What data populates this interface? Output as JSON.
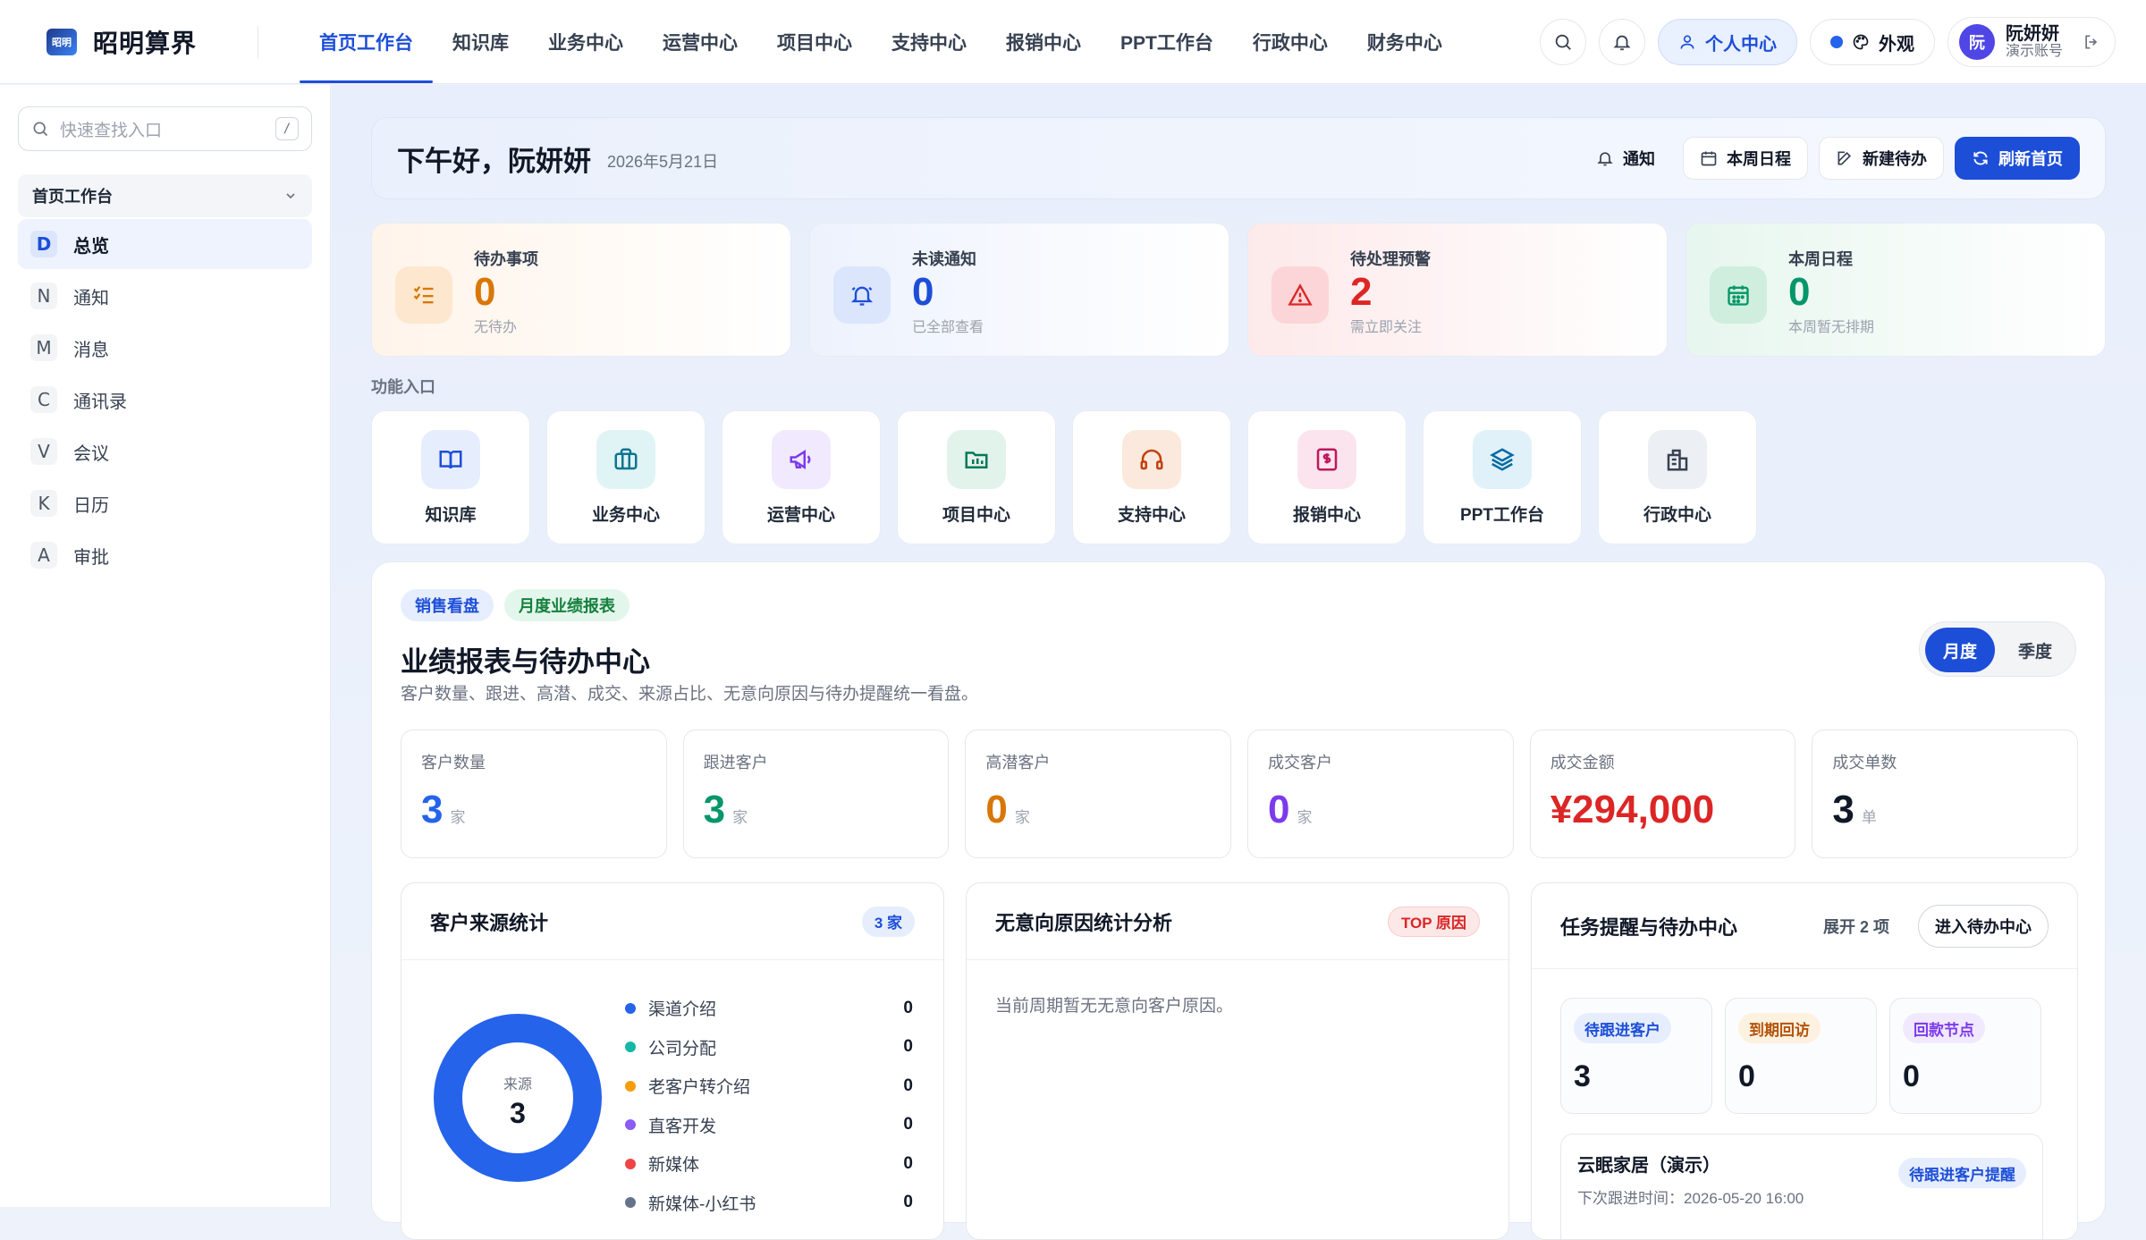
{
  "app": {
    "name": "昭明算界",
    "logo_text": "昭明"
  },
  "nav": {
    "items": [
      "首页工作台",
      "知识库",
      "业务中心",
      "运营中心",
      "项目中心",
      "支持中心",
      "报销中心",
      "PPT工作台",
      "行政中心",
      "财务中心"
    ],
    "active_index": 0
  },
  "topbar": {
    "personal_label": "个人中心",
    "appearance_label": "外观",
    "user": {
      "avatar": "阮",
      "name": "阮妍妍",
      "role": "演示账号"
    }
  },
  "sidebar": {
    "search_placeholder": "快速查找入口",
    "search_shortcut": "/",
    "group_title": "首页工作台",
    "items": [
      {
        "letter": "D",
        "label": "总览",
        "active": true
      },
      {
        "letter": "N",
        "label": "通知"
      },
      {
        "letter": "M",
        "label": "消息"
      },
      {
        "letter": "C",
        "label": "通讯录"
      },
      {
        "letter": "V",
        "label": "会议"
      },
      {
        "letter": "K",
        "label": "日历"
      },
      {
        "letter": "A",
        "label": "审批"
      }
    ]
  },
  "greeting": {
    "title": "下午好，阮妍妍",
    "date": "2026年5月21日",
    "actions": {
      "notify": "通知",
      "week": "本周日程",
      "new_todo": "新建待办",
      "refresh": "刷新首页"
    }
  },
  "stats": [
    {
      "label": "待办事项",
      "value": "0",
      "sub": "无待办",
      "color": "#d97706",
      "icon": "checklist-icon"
    },
    {
      "label": "未读通知",
      "value": "0",
      "sub": "已全部查看",
      "color": "#1d4ed8",
      "icon": "bell-icon"
    },
    {
      "label": "待处理预警",
      "value": "2",
      "sub": "需立即关注",
      "color": "#dc2626",
      "icon": "warning-icon"
    },
    {
      "label": "本周日程",
      "value": "0",
      "sub": "本周暂无排期",
      "color": "#059669",
      "icon": "calendar-icon"
    }
  ],
  "functions": {
    "title": "功能入口",
    "items": [
      {
        "label": "知识库",
        "icon": "book-icon"
      },
      {
        "label": "业务中心",
        "icon": "briefcase-icon"
      },
      {
        "label": "运营中心",
        "icon": "megaphone-icon"
      },
      {
        "label": "项目中心",
        "icon": "folder-icon"
      },
      {
        "label": "支持中心",
        "icon": "headphones-icon"
      },
      {
        "label": "报销中心",
        "icon": "receipt-icon"
      },
      {
        "label": "PPT工作台",
        "icon": "layers-icon"
      },
      {
        "label": "行政中心",
        "icon": "building-icon"
      }
    ]
  },
  "board": {
    "tags": [
      "销售看盘",
      "月度业绩报表"
    ],
    "title": "业绩报表与待办中心",
    "desc": "客户数量、跟进、高潜、成交、来源占比、无意向原因与待办提醒统一看盘。",
    "period": {
      "monthly": "月度",
      "quarterly": "季度",
      "active": "monthly"
    },
    "kpis": [
      {
        "label": "客户数量",
        "value": "3",
        "unit": "家",
        "color": "#2563eb"
      },
      {
        "label": "跟进客户",
        "value": "3",
        "unit": "家",
        "color": "#059669"
      },
      {
        "label": "高潜客户",
        "value": "0",
        "unit": "家",
        "color": "#d97706"
      },
      {
        "label": "成交客户",
        "value": "0",
        "unit": "家",
        "color": "#7c3aed"
      },
      {
        "label": "成交金额",
        "value": "¥294,000",
        "unit": "",
        "color": "#dc2626"
      },
      {
        "label": "成交单数",
        "value": "3",
        "unit": "单",
        "color": "#111827"
      }
    ],
    "source": {
      "title": "客户来源统计",
      "badge": "3 家",
      "donut_label": "来源",
      "donut_total": "3",
      "legend": [
        {
          "name": "渠道介绍",
          "value": "0",
          "color": "#2563eb"
        },
        {
          "name": "公司分配",
          "value": "0",
          "color": "#14b8a6"
        },
        {
          "name": "老客户转介绍",
          "value": "0",
          "color": "#f59e0b"
        },
        {
          "name": "直客开发",
          "value": "0",
          "color": "#8b5cf6"
        },
        {
          "name": "新媒体",
          "value": "0",
          "color": "#ef4444"
        },
        {
          "name": "新媒体-小红书",
          "value": "0",
          "color": "#64748b"
        }
      ]
    },
    "reasons": {
      "title": "无意向原因统计分析",
      "badge": "TOP 原因",
      "empty": "当前周期暂无无意向客户原因。"
    },
    "tasks": {
      "title": "任务提醒与待办中心",
      "expand": "展开 2 项",
      "enter": "进入待办中心",
      "minis": [
        {
          "label": "待跟进客户",
          "value": "3",
          "bg": "#e6eefd",
          "fg": "#1d4ed8"
        },
        {
          "label": "到期回访",
          "value": "0",
          "bg": "#fdf1e0",
          "fg": "#b45309"
        },
        {
          "label": "回款节点",
          "value": "0",
          "bg": "#f1e9fd",
          "fg": "#7c3aed"
        }
      ],
      "item": {
        "name": "云眠家居（演示）",
        "time": "下次跟进时间：2026-05-20 16:00",
        "tag": "待跟进客户提醒"
      }
    }
  }
}
